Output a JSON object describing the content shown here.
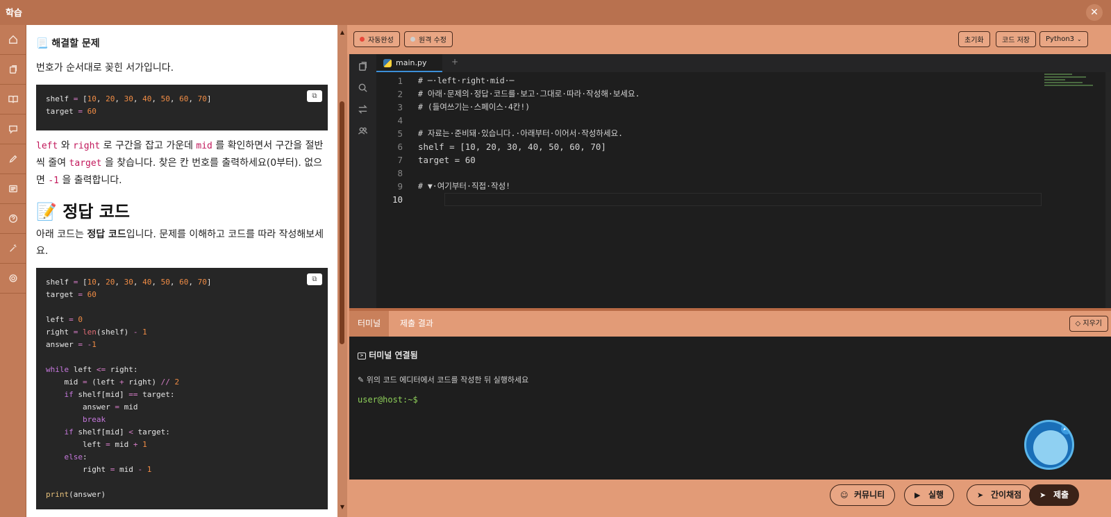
{
  "window": {
    "title": "학습",
    "close_glyph": "✕"
  },
  "rail": {
    "icons": [
      "home-icon",
      "copy-icon",
      "book-icon",
      "chat-icon",
      "pencil-icon",
      "list-icon",
      "help-icon",
      "wand-icon",
      "settings-icon"
    ]
  },
  "lesson": {
    "problem_heading": "해결할 문제",
    "problem_heading_icon": "📃",
    "intro": "번호가 순서대로 꽂힌 서가입니다.",
    "code1_line1": "shelf = [10, 20, 30, 40, 50, 60, 70]",
    "code1_line2": "target = 60",
    "desc_left": "left",
    "desc_w1": " 와 ",
    "desc_right": "right",
    "desc_w2": " 로 구간을 잡고 가운데 ",
    "desc_mid": "mid",
    "desc_w3": " 를 확인하면서 구간을 절반씩 줄여 ",
    "desc_target": "target",
    "desc_w4": " 을 찾습니다. 찾은 칸 번호를 출력하세요(0부터). 없으면 ",
    "desc_neg": "-1",
    "desc_w5": " 을 출력합니다.",
    "answer_heading": "정답 코드",
    "answer_heading_icon": "📝",
    "answer_intro_pre": "아래 코드는 ",
    "answer_intro_bold": "정답 코드",
    "answer_intro_post": "입니다. 문제를 이해하고 코드를 따라 작성해보세요."
  },
  "toolbar": {
    "autocomplete": "자동완성",
    "autocomplete_color": "#e8473a",
    "remote_edit": "원격 수정",
    "remote_edit_color": "#cfcfcf",
    "reset": "초기화",
    "save": "코드 저장",
    "language": "Python3"
  },
  "editor": {
    "filename": "main.py",
    "add_tab": "+",
    "lines": [
      "# ─·left·right·mid·─",
      "# 아래·문제의·정답·코드를·보고·그대로·따라·작성해·보세요.",
      "# (들여쓰기는·스페이스·4칸!)",
      "",
      "# 자료는·준비돼·있습니다.·아래부터·이어서·작성하세요.",
      "shelf = [10, 20, 30, 40, 50, 60, 70]",
      "target = 60",
      "",
      "# ▼·여기부터·직접·작성!",
      ""
    ]
  },
  "terminal": {
    "tab_terminal": "터미널",
    "tab_results": "제출 결과",
    "clear": "지우기",
    "connected": "터미널 연결됨",
    "hint": "위의 코드 에디터에서 코드를 작성한 뒤 실행하세요",
    "prompt": "user@host:~$"
  },
  "assistant": {
    "badge": "AI"
  },
  "actions": {
    "community": "커뮤니티",
    "run": "실행",
    "quick_grade": "간이채점",
    "submit": "제출"
  }
}
